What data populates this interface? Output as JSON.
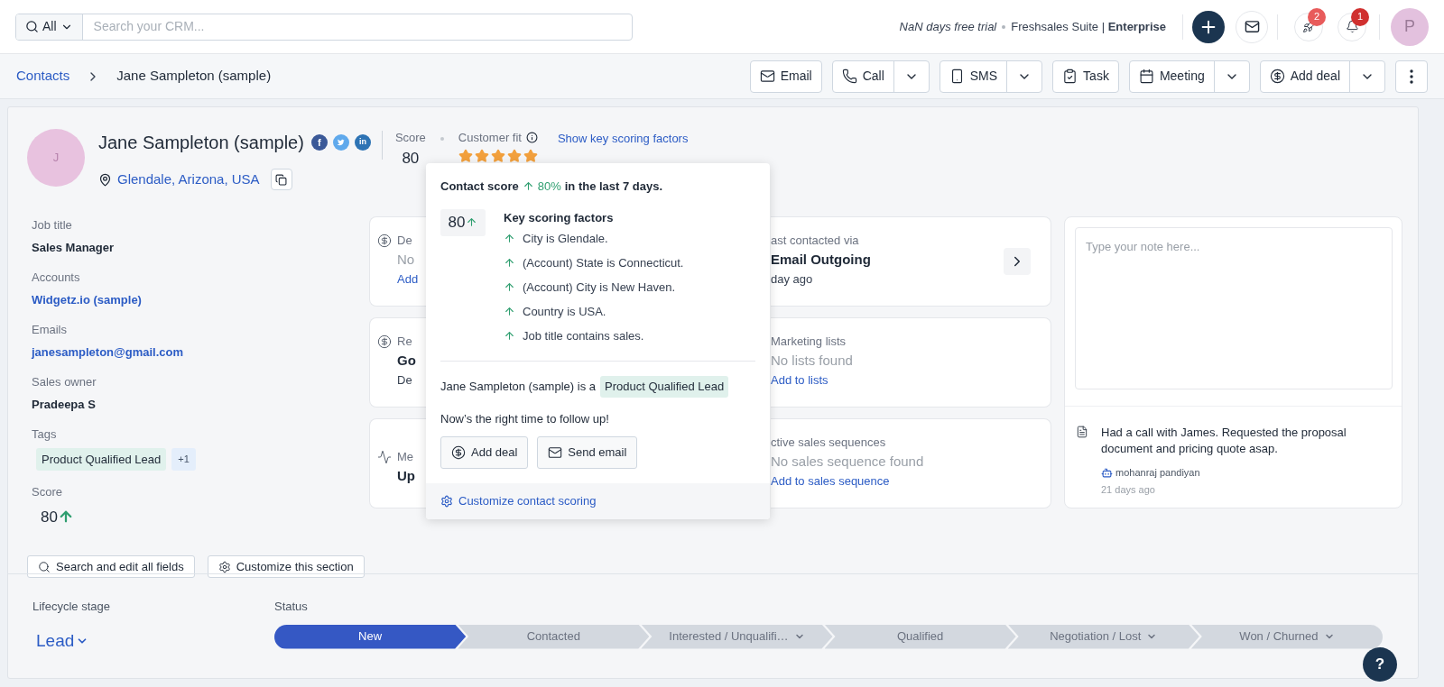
{
  "topbar": {
    "search_scope": "All",
    "search_placeholder": "Search your CRM...",
    "trial": "NaN days free trial",
    "plan": "Freshsales Suite | **Enterprise**",
    "badges": [
      {
        "kind": "rocket",
        "count": "2",
        "color": "#e85b5b"
      },
      {
        "kind": "bell",
        "count": "1",
        "color": "#d0302f"
      }
    ],
    "avatar": "P"
  },
  "breadcrumb": {
    "parent": "Contacts",
    "current": "Jane Sampleton (sample)"
  },
  "actions": [
    {
      "kind": "email",
      "label": "Email",
      "dropdown": false
    },
    {
      "kind": "call",
      "label": "Call",
      "dropdown": true
    },
    {
      "kind": "sms",
      "label": "SMS",
      "dropdown": true
    },
    {
      "kind": "task",
      "label": "Task",
      "dropdown": false
    },
    {
      "kind": "meeting",
      "label": "Meeting",
      "dropdown": true
    },
    {
      "kind": "deal",
      "label": "Add deal",
      "dropdown": true
    }
  ],
  "contact": {
    "initial": "J",
    "name": "Jane Sampleton (sample)",
    "location": "Glendale, Arizona, USA",
    "socials": [
      {
        "kind": "facebook",
        "glyph": "f"
      },
      {
        "kind": "twitter"
      },
      {
        "kind": "linkedin",
        "glyph": "in"
      }
    ],
    "score_label": "Score",
    "score": "80",
    "fit_label": "Customer fit",
    "stars": 5,
    "factors_link": "Show key scoring factors"
  },
  "fields": [
    {
      "kind": "text",
      "label": "Job title",
      "value": "Sales Manager"
    },
    {
      "kind": "link",
      "label": "Accounts",
      "value": "Widgetz.io (sample)"
    },
    {
      "kind": "link",
      "label": "Emails",
      "value": "janesampleton@gmail.com"
    },
    {
      "kind": "text",
      "label": "Sales owner",
      "value": "Pradeepa S"
    },
    {
      "kind": "tags",
      "label": "Tags",
      "tags": [
        "Product Qualified Lead"
      ],
      "more": "+1"
    },
    {
      "kind": "score",
      "label": "Score",
      "value": "80"
    }
  ],
  "cards": [
    {
      "left": {
        "kind": "money",
        "lines": [
          {
            "kind": "label",
            "text": "De"
          },
          {
            "kind": "muted",
            "text": "No"
          },
          {
            "kind": "link",
            "text": "Add"
          }
        ]
      },
      "right": {
        "arrow": true,
        "lines": [
          {
            "kind": "label",
            "text": "ast contacted via"
          },
          {
            "kind": "value",
            "text": "Email Outgoing"
          },
          {
            "kind": "sub",
            "text": "day ago"
          }
        ]
      }
    },
    {
      "left": {
        "kind": "money",
        "lines": [
          {
            "kind": "label",
            "text": "Re"
          },
          {
            "kind": "value",
            "text": "Go"
          },
          {
            "kind": "sub",
            "text": "De"
          }
        ]
      },
      "right": {
        "arrow": false,
        "lines": [
          {
            "kind": "label",
            "text": "Marketing lists"
          },
          {
            "kind": "muted",
            "text": "No lists found"
          },
          {
            "kind": "link",
            "text": "Add to lists"
          }
        ]
      }
    },
    {
      "left": {
        "kind": "activity",
        "lines": [
          {
            "kind": "label",
            "text": "Me"
          },
          {
            "kind": "value",
            "text": "Up"
          }
        ]
      },
      "right": {
        "arrow": false,
        "lines": [
          {
            "kind": "label",
            "text": "ctive sales sequences"
          },
          {
            "kind": "muted",
            "text": "No sales sequence found"
          },
          {
            "kind": "link",
            "text": "Add to sales sequence"
          }
        ]
      }
    }
  ],
  "notes": {
    "placeholder": "Type your note here...",
    "entries": [
      {
        "text": "Had a call with James. Requested the proposal document and pricing quote asap.",
        "author": "mohanraj pandiyan",
        "time": "21 days ago"
      }
    ]
  },
  "popup": {
    "prefix": "Contact score",
    "change": "80%",
    "suffix": "in the last 7 days.",
    "score": "80",
    "factors_title": "Key scoring factors",
    "factors": [
      "City is Glendale.",
      "(Account) State is Connecticut.",
      "(Account) City is New Haven.",
      "Country is USA.",
      "Job title contains sales."
    ],
    "lead_prefix": "Jane Sampleton (sample) is a",
    "lead_tag": "Product Qualified Lead",
    "advice": "Now’s the right time to follow up!",
    "buttons": [
      {
        "kind": "deal",
        "label": "Add deal"
      },
      {
        "kind": "email",
        "label": "Send email"
      }
    ],
    "footer": "Customize contact scoring"
  },
  "section_buttons": [
    {
      "kind": "search",
      "label": "Search and edit all fields"
    },
    {
      "kind": "settings",
      "label": "Customize this section"
    }
  ],
  "lifecycle": {
    "label": "Lifecycle stage",
    "value": "Lead",
    "status_label": "Status",
    "steps": [
      {
        "label": "New",
        "selected": true,
        "dropdown": false
      },
      {
        "label": "Contacted",
        "selected": false,
        "dropdown": false
      },
      {
        "label": "Interested / Unqualifi…",
        "selected": false,
        "dropdown": true
      },
      {
        "label": "Qualified",
        "selected": false,
        "dropdown": false
      },
      {
        "label": "Negotiation / Lost",
        "selected": false,
        "dropdown": true
      },
      {
        "label": "Won / Churned",
        "selected": false,
        "dropdown": true
      }
    ]
  },
  "help": "?"
}
